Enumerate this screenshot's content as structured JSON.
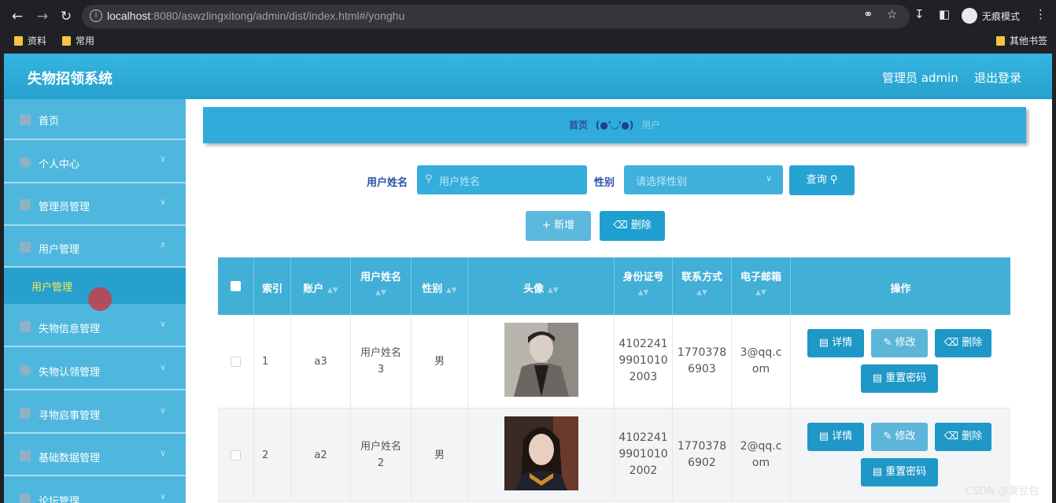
{
  "browser": {
    "url_host": "localhost",
    "url_rest": ":8080/aswzlingxitong/admin/dist/index.html#/yonghu",
    "incognito_label": "无痕模式",
    "bookmarks": [
      "资料",
      "常用"
    ],
    "other_bookmarks": "其他书签"
  },
  "header": {
    "title": "失物招领系统",
    "admin": "管理员 admin",
    "logout": "退出登录"
  },
  "sidebar": {
    "items": [
      {
        "label": "首页",
        "icon": "home-icon"
      },
      {
        "label": "个人中心",
        "icon": "user-icon"
      },
      {
        "label": "管理员管理",
        "icon": "send-icon"
      },
      {
        "label": "用户管理",
        "icon": "monitor-icon"
      },
      {
        "label": "失物信息管理",
        "icon": "copy-icon"
      },
      {
        "label": "失物认领管理",
        "icon": "circle-icon"
      },
      {
        "label": "寻物启事管理",
        "icon": "monitor-icon"
      },
      {
        "label": "基础数据管理",
        "icon": "message-icon"
      },
      {
        "label": "论坛管理",
        "icon": "mic-icon"
      }
    ],
    "active_sub": "用户管理"
  },
  "breadcrumb": {
    "home": "首页",
    "separator": "(●'◡'●)",
    "current": "用户"
  },
  "search": {
    "name_label": "用户姓名",
    "name_placeholder": "用户姓名",
    "gender_label": "性别",
    "gender_placeholder": "请选择性别",
    "query_button": "查询",
    "add_button": "新增",
    "delete_button": "删除"
  },
  "table": {
    "headers": [
      "索引",
      "账户",
      "用户姓名",
      "性别",
      "头像",
      "身份证号",
      "联系方式",
      "电子邮箱",
      "操作"
    ],
    "rows": [
      {
        "index": "1",
        "account": "a3",
        "name": [
          "用户姓名",
          "3"
        ],
        "gender": "男",
        "id_card": [
          "4102241",
          "9901010",
          "2003"
        ],
        "phone": [
          "1770378",
          "6903"
        ],
        "email": [
          "3@qq.c",
          "om"
        ]
      },
      {
        "index": "2",
        "account": "a2",
        "name": [
          "用户姓名",
          "2"
        ],
        "gender": "男",
        "id_card": [
          "4102241",
          "9901010",
          "2002"
        ],
        "phone": [
          "1770378",
          "6902"
        ],
        "email": [
          "2@qq.c",
          "om"
        ]
      }
    ],
    "actions": {
      "detail": "详情",
      "edit": "修改",
      "delete": "删除",
      "reset": "重置密码"
    }
  },
  "colors": {
    "header": "#2aa3d0",
    "sidebar": "#4fb7dd",
    "accent": "#1f97c7"
  },
  "watermark": "CSDN @栗豆包"
}
